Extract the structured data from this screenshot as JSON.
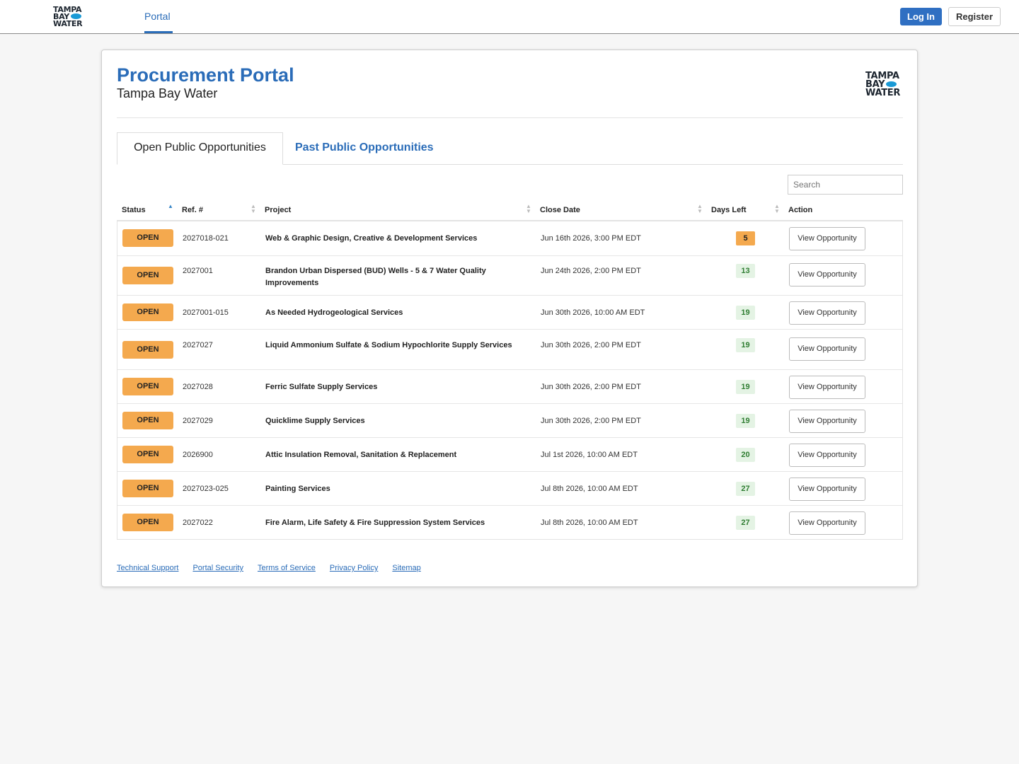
{
  "brand": {
    "logo_line1": "TAMPA",
    "logo_line2": "BAY",
    "logo_line3": "WATER"
  },
  "nav": {
    "portal_label": "Portal",
    "login_label": "Log In",
    "register_label": "Register"
  },
  "page": {
    "title": "Procurement Portal",
    "subtitle": "Tampa Bay Water"
  },
  "tabs": {
    "active": "Open Public Opportunities",
    "other": "Past Public Opportunities"
  },
  "search": {
    "placeholder": "Search"
  },
  "table": {
    "columns": {
      "status": "Status",
      "ref": "Ref. #",
      "project": "Project",
      "close_date": "Close Date",
      "days_left": "Days Left",
      "action": "Action"
    },
    "rows": [
      {
        "status": "OPEN",
        "ref": "2027018-021",
        "project": "Web & Graphic Design, Creative & Development Services",
        "close_date": "Jun 16th 2026, 3:00 PM EDT",
        "days_left": "5",
        "action": "View Opportunity"
      },
      {
        "status": "OPEN",
        "ref": "2027001",
        "project": "Brandon Urban Dispersed (BUD) Wells - 5 & 7 Water Quality Improvements",
        "close_date": "Jun 24th 2026, 2:00 PM EDT",
        "days_left": "13",
        "action": "View Opportunity"
      },
      {
        "status": "OPEN",
        "ref": "2027001-015",
        "project": "As Needed Hydrogeological Services",
        "close_date": "Jun 30th 2026, 10:00 AM EDT",
        "days_left": "19",
        "action": "View Opportunity"
      },
      {
        "status": "OPEN",
        "ref": "2027027",
        "project": "Liquid Ammonium Sulfate & Sodium Hypochlorite Supply Services",
        "close_date": "Jun 30th 2026, 2:00 PM EDT",
        "days_left": "19",
        "action": "View Opportunity"
      },
      {
        "status": "OPEN",
        "ref": "2027028",
        "project": "Ferric Sulfate Supply Services",
        "close_date": "Jun 30th 2026, 2:00 PM EDT",
        "days_left": "19",
        "action": "View Opportunity"
      },
      {
        "status": "OPEN",
        "ref": "2027029",
        "project": "Quicklime Supply Services",
        "close_date": "Jun 30th 2026, 2:00 PM EDT",
        "days_left": "19",
        "action": "View Opportunity"
      },
      {
        "status": "OPEN",
        "ref": "2026900",
        "project": "Attic Insulation Removal, Sanitation & Replacement",
        "close_date": "Jul 1st 2026, 10:00 AM EDT",
        "days_left": "20",
        "action": "View Opportunity"
      },
      {
        "status": "OPEN",
        "ref": "2027023-025",
        "project": "Painting Services",
        "close_date": "Jul 8th 2026, 10:00 AM EDT",
        "days_left": "27",
        "action": "View Opportunity"
      },
      {
        "status": "OPEN",
        "ref": "2027022",
        "project": "Fire Alarm, Life Safety & Fire Suppression System Services",
        "close_date": "Jul 8th 2026, 10:00 AM EDT",
        "days_left": "27",
        "action": "View Opportunity"
      }
    ]
  },
  "footer": {
    "links": [
      "Technical Support",
      "Portal Security",
      "Terms of Service",
      "Privacy Policy",
      "Sitemap"
    ]
  },
  "colors": {
    "brand_blue": "#2a6cb8",
    "open_badge": "#f4a94e",
    "days_ok_bg": "#e4f3e4",
    "days_ok_text": "#2f7d32"
  }
}
